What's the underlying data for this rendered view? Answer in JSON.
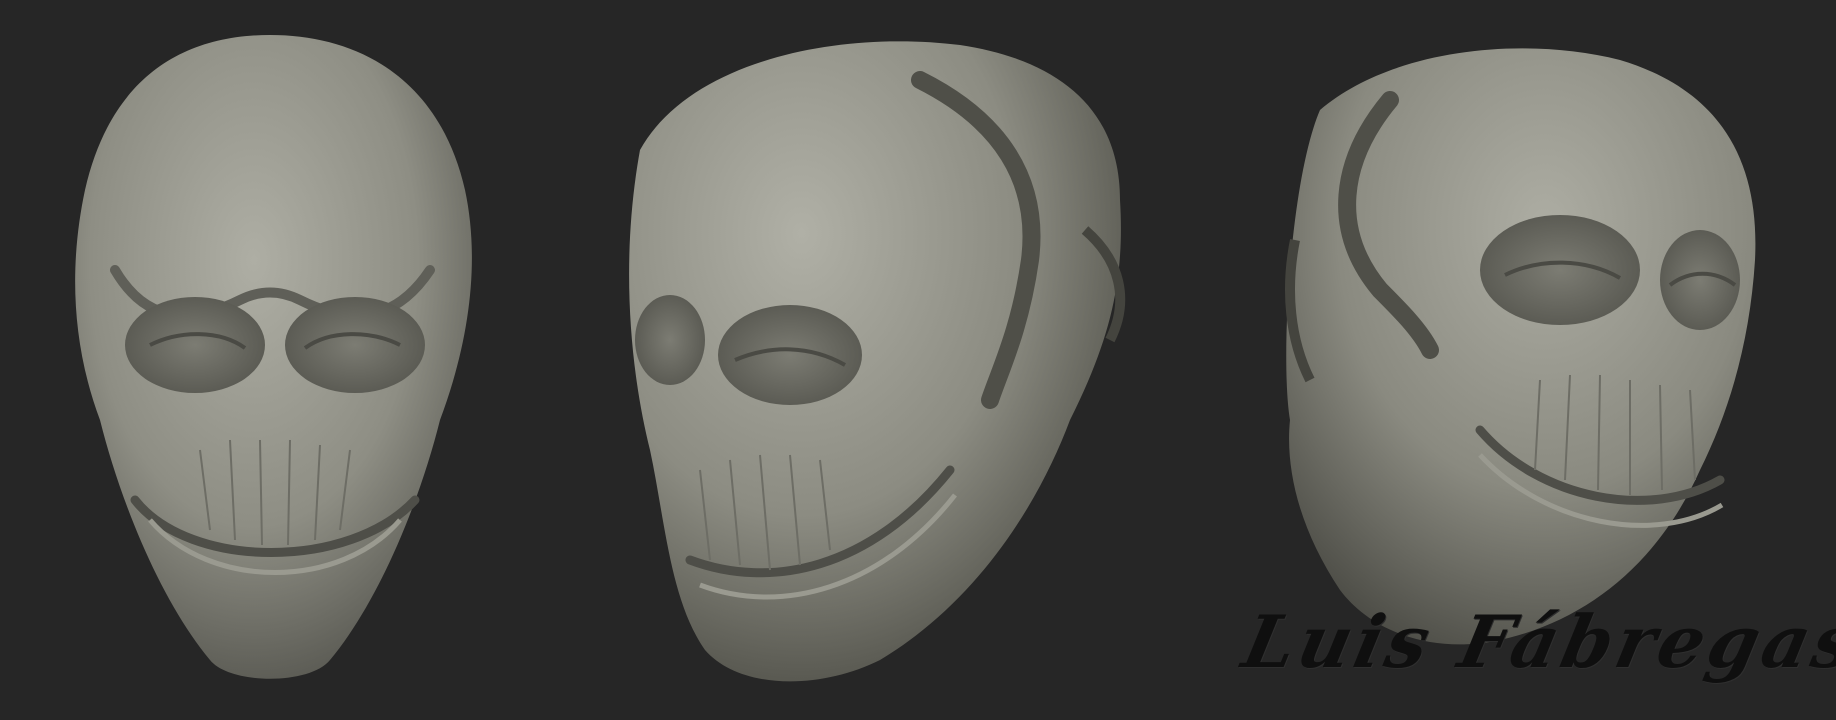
{
  "signature": {
    "text": "Luis Fábregas"
  },
  "colors": {
    "background": "#262626",
    "clay_light": "#a6a69c",
    "clay_mid": "#8a8a80",
    "clay_dark": "#4e4e48",
    "signature": "#0f0f0f"
  },
  "views": [
    {
      "name": "front-view"
    },
    {
      "name": "three-quarter-left-view"
    },
    {
      "name": "three-quarter-right-view"
    }
  ]
}
